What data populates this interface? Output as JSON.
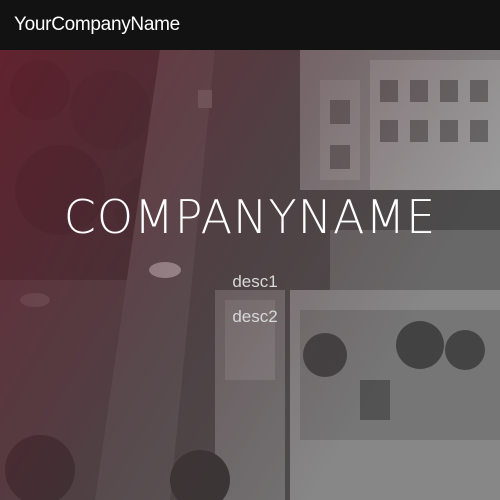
{
  "navbar": {
    "brand": "YourCompanyName"
  },
  "hero": {
    "title": "COMPANYNAME",
    "descriptions": [
      "desc1",
      "desc2"
    ]
  },
  "colors": {
    "navbar_bg": "#121212",
    "overlay_accent": "#7a1428"
  }
}
